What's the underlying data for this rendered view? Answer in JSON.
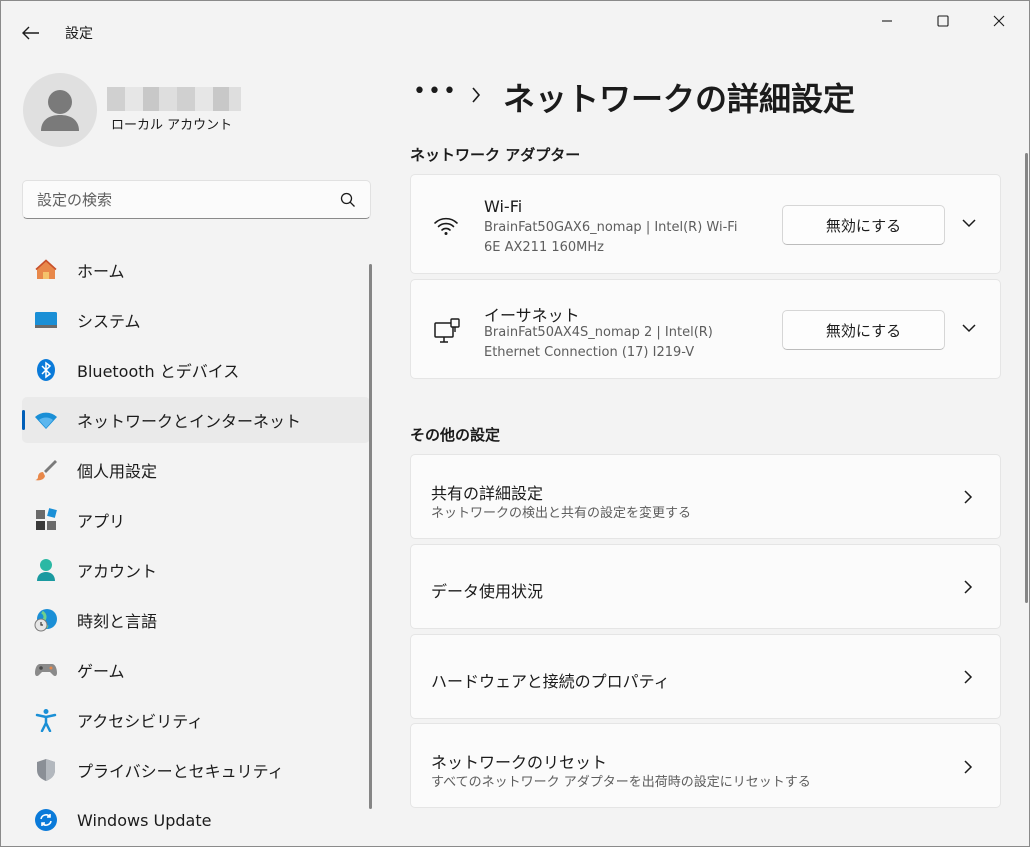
{
  "window": {
    "title": "設定"
  },
  "profile": {
    "account_type": "ローカル アカウント"
  },
  "search": {
    "placeholder": "設定の検索"
  },
  "nav": {
    "items": [
      {
        "label": "ホーム",
        "icon": "home-icon"
      },
      {
        "label": "システム",
        "icon": "system-icon"
      },
      {
        "label": "Bluetooth とデバイス",
        "icon": "bluetooth-icon"
      },
      {
        "label": "ネットワークとインターネット",
        "icon": "network-icon",
        "active": true
      },
      {
        "label": "個人用設定",
        "icon": "brush-icon"
      },
      {
        "label": "アプリ",
        "icon": "apps-icon"
      },
      {
        "label": "アカウント",
        "icon": "account-icon"
      },
      {
        "label": "時刻と言語",
        "icon": "time-language-icon"
      },
      {
        "label": "ゲーム",
        "icon": "gamepad-icon"
      },
      {
        "label": "アクセシビリティ",
        "icon": "accessibility-icon"
      },
      {
        "label": "プライバシーとセキュリティ",
        "icon": "shield-icon"
      },
      {
        "label": "Windows Update",
        "icon": "windows-update-icon"
      }
    ]
  },
  "breadcrumb": {
    "ellipsis": "•••"
  },
  "page": {
    "title": "ネットワークの詳細設定"
  },
  "adapters": {
    "section_title": "ネットワーク アダプター",
    "items": [
      {
        "name": "Wi-Fi",
        "desc_line1": "BrainFat50GAX6_nomap | Intel(R) Wi-Fi",
        "desc_line2": "6E AX211 160MHz",
        "button": "無効にする",
        "icon": "wifi-icon"
      },
      {
        "name": "イーサネット",
        "desc_line1": "BrainFat50AX4S_nomap 2 | Intel(R)",
        "desc_line2": "Ethernet Connection (17) I219-V",
        "button": "無効にする",
        "icon": "ethernet-icon"
      }
    ]
  },
  "other": {
    "section_title": "その他の設定",
    "items": [
      {
        "title": "共有の詳細設定",
        "sub": "ネットワークの検出と共有の設定を変更する"
      },
      {
        "title": "データ使用状況",
        "sub": ""
      },
      {
        "title": "ハードウェアと接続のプロパティ",
        "sub": ""
      },
      {
        "title": "ネットワークのリセット",
        "sub": "すべてのネットワーク アダプターを出荷時の設定にリセットする"
      }
    ]
  },
  "colors": {
    "accent": "#005fb8",
    "background": "#f3f3f3",
    "card": "#fbfbfb"
  }
}
